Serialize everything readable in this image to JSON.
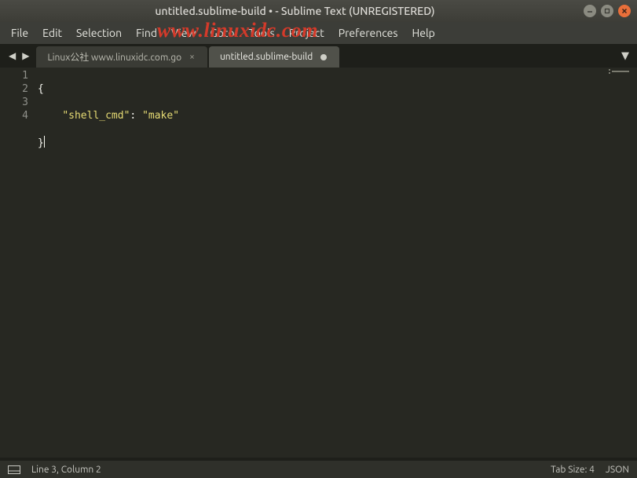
{
  "window": {
    "title": "untitled.sublime-build • - Sublime Text (UNREGISTERED)"
  },
  "menu": {
    "file": "File",
    "edit": "Edit",
    "selection": "Selection",
    "find": "Find",
    "view": "View",
    "goto": "Goto",
    "tools": "Tools",
    "project": "Project",
    "preferences": "Preferences",
    "help": "Help"
  },
  "watermark": "www.linuxidc.com",
  "tabs": [
    {
      "label": "Linux公社 www.linuxidc.com.go",
      "active": false,
      "dirty": false
    },
    {
      "label": "untitled.sublime-build",
      "active": true,
      "dirty": true
    }
  ],
  "gutter": {
    "l1": "1",
    "l2": "2",
    "l3": "3",
    "l4": "4"
  },
  "code": {
    "line1_brace": "{",
    "line2_indent": "    ",
    "line2_key": "\"shell_cmd\"",
    "line2_colon": ": ",
    "line2_val": "\"make\"",
    "line3_brace": "}"
  },
  "status": {
    "position": "Line 3, Column 2",
    "tab_size": "Tab Size: 4",
    "syntax": "JSON"
  }
}
